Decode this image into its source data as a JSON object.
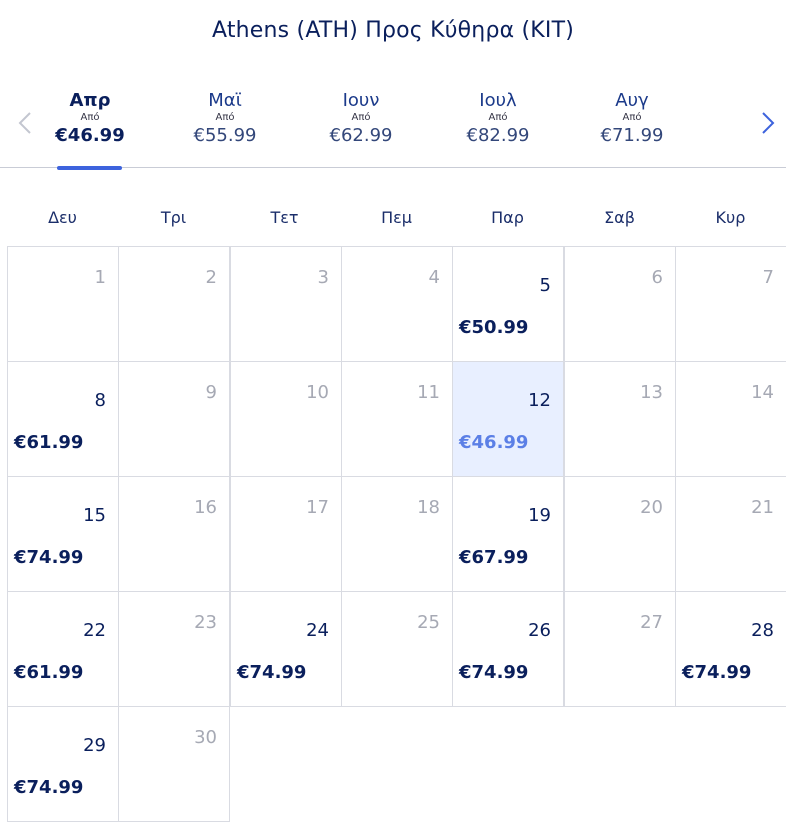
{
  "header": {
    "title": "Athens (ATH) Προς Κύθηρα (KIT)"
  },
  "months": [
    {
      "name": "Απρ",
      "from": "Από",
      "price": "€46.99",
      "active": true
    },
    {
      "name": "Μαϊ",
      "from": "Από",
      "price": "€55.99",
      "active": false
    },
    {
      "name": "Ιουν",
      "from": "Από",
      "price": "€62.99",
      "active": false
    },
    {
      "name": "Ιουλ",
      "from": "Από",
      "price": "€82.99",
      "active": false
    },
    {
      "name": "Αυγ",
      "from": "Από",
      "price": "€71.99",
      "active": false
    }
  ],
  "nav": {
    "prev_icon": "chevron-left-icon",
    "next_icon": "chevron-right-icon"
  },
  "weekdays": [
    "Δευ",
    "Τρι",
    "Τετ",
    "Πεμ",
    "Παρ",
    "Σαβ",
    "Κυρ"
  ],
  "calendar": {
    "start_weekday": 0,
    "days": [
      {
        "day": "1",
        "price": ""
      },
      {
        "day": "2",
        "price": ""
      },
      {
        "day": "3",
        "price": ""
      },
      {
        "day": "4",
        "price": ""
      },
      {
        "day": "5",
        "price": "€50.99"
      },
      {
        "day": "6",
        "price": ""
      },
      {
        "day": "7",
        "price": ""
      },
      {
        "day": "8",
        "price": "€61.99"
      },
      {
        "day": "9",
        "price": ""
      },
      {
        "day": "10",
        "price": ""
      },
      {
        "day": "11",
        "price": ""
      },
      {
        "day": "12",
        "price": "€46.99",
        "selected": true
      },
      {
        "day": "13",
        "price": ""
      },
      {
        "day": "14",
        "price": ""
      },
      {
        "day": "15",
        "price": "€74.99"
      },
      {
        "day": "16",
        "price": ""
      },
      {
        "day": "17",
        "price": ""
      },
      {
        "day": "18",
        "price": ""
      },
      {
        "day": "19",
        "price": "€67.99"
      },
      {
        "day": "20",
        "price": ""
      },
      {
        "day": "21",
        "price": ""
      },
      {
        "day": "22",
        "price": "€61.99"
      },
      {
        "day": "23",
        "price": ""
      },
      {
        "day": "24",
        "price": "€74.99"
      },
      {
        "day": "25",
        "price": ""
      },
      {
        "day": "26",
        "price": "€74.99"
      },
      {
        "day": "27",
        "price": ""
      },
      {
        "day": "28",
        "price": "€74.99"
      },
      {
        "day": "29",
        "price": "€74.99"
      },
      {
        "day": "30",
        "price": ""
      }
    ]
  },
  "colors": {
    "primary": "#0a1f5c",
    "accent": "#3d63dd",
    "selected_bg": "#e8efff",
    "selected_price": "#5b7fe6",
    "disabled_day": "#a6a9b4"
  }
}
